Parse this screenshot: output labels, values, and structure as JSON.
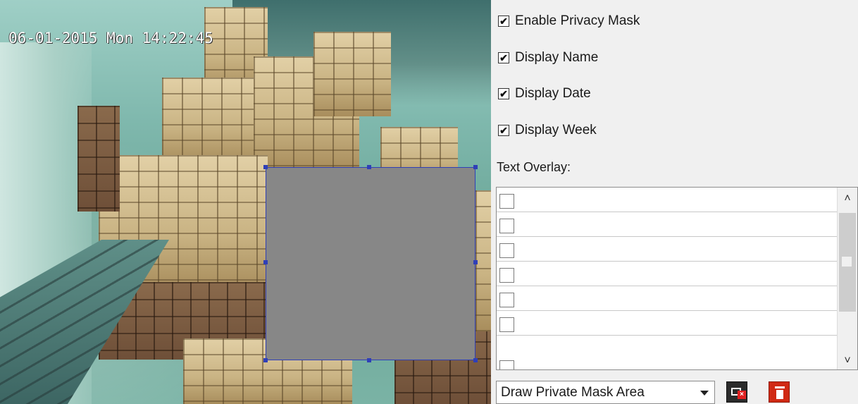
{
  "video": {
    "osd_datetime": "06-01-2015 Mon 14:22:45",
    "mask_color": "#878787",
    "mask_border_color": "#2f3fb8"
  },
  "options": {
    "enable_privacy_mask": {
      "label": "Enable Privacy Mask",
      "checked": true
    },
    "display_name": {
      "label": "Display Name",
      "checked": true
    },
    "display_date": {
      "label": "Display Date",
      "checked": true
    },
    "display_week": {
      "label": "Display Week",
      "checked": true
    }
  },
  "text_overlay": {
    "label": "Text Overlay:",
    "rows": [
      {
        "checked": false,
        "text": ""
      },
      {
        "checked": false,
        "text": ""
      },
      {
        "checked": false,
        "text": ""
      },
      {
        "checked": false,
        "text": ""
      },
      {
        "checked": false,
        "text": ""
      },
      {
        "checked": false,
        "text": ""
      },
      {
        "checked": false,
        "text": ""
      }
    ]
  },
  "toolbar": {
    "mode_select_value": "Draw Private Mask Area",
    "clear_icon": "clear-screen-icon",
    "delete_icon": "trash-icon",
    "clear_color": "#2b2b2b",
    "delete_color": "#d02a14"
  }
}
